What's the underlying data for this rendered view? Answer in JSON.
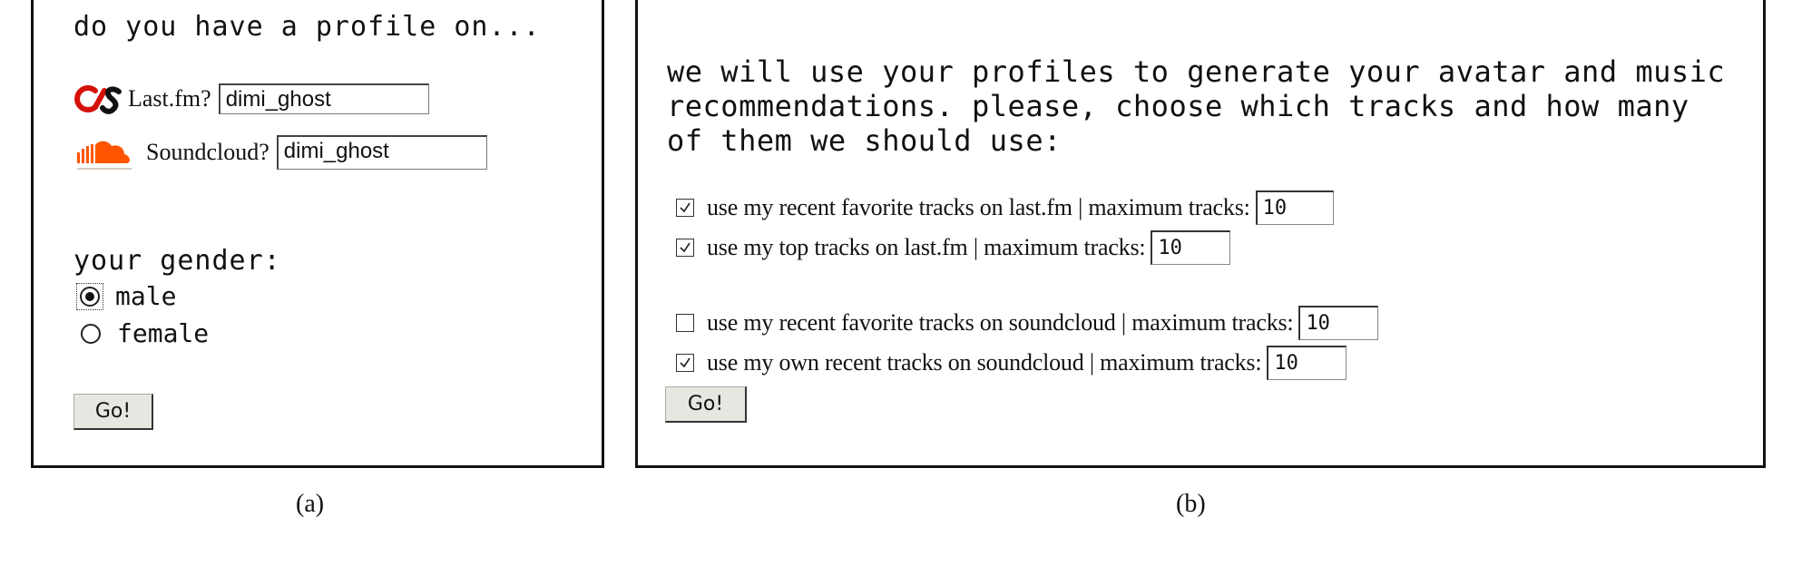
{
  "panel_a": {
    "title": "do you have a profile on...",
    "services": [
      {
        "icon": "lastfm-logo-icon",
        "label": "Last.fm?",
        "value": "dimi_ghost",
        "color": "#d51007"
      },
      {
        "icon": "soundcloud-logo-icon",
        "label": "Soundcloud?",
        "value": "dimi_ghost",
        "color": "#ff5500"
      }
    ],
    "gender_label": "your gender:",
    "gender_options": [
      {
        "label": "male",
        "selected": true
      },
      {
        "label": "female",
        "selected": false
      }
    ],
    "go_label": "Go!"
  },
  "panel_b": {
    "intro_lines": [
      "we will use your profiles to generate your avatar and music",
      "recommendations. please, choose which tracks and how many",
      "of them we should use:"
    ],
    "options": [
      {
        "label": "use my recent favorite tracks on last.fm | maximum tracks:",
        "checked": true,
        "value": "10"
      },
      {
        "label": "use my top tracks on last.fm | maximum tracks:",
        "checked": true,
        "value": "10"
      },
      {
        "label": "use my recent favorite tracks on soundcloud | maximum tracks:",
        "checked": false,
        "value": "10"
      },
      {
        "label": "use my own recent tracks on soundcloud | maximum tracks:",
        "checked": true,
        "value": "10"
      }
    ],
    "go_label": "Go!"
  },
  "captions": {
    "a": "(a)",
    "b": "(b)"
  }
}
